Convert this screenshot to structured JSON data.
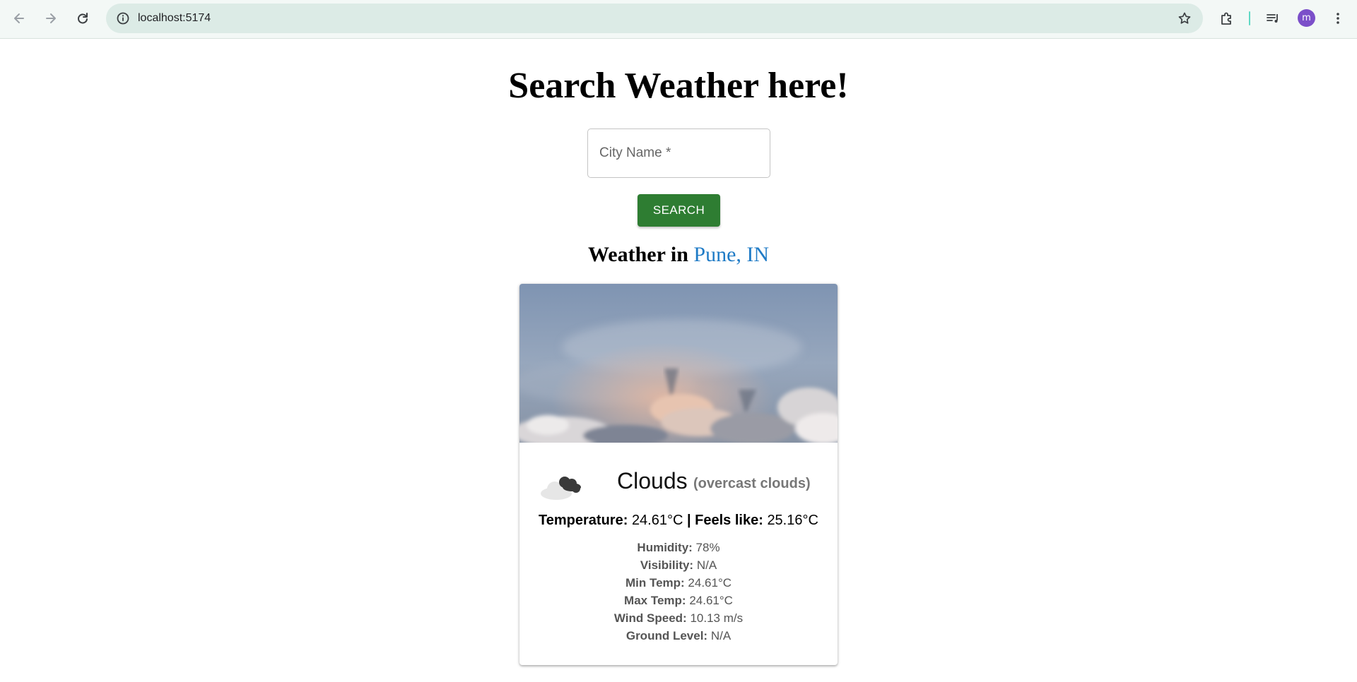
{
  "browser": {
    "url": "localhost:5174",
    "profile_initial": "m",
    "icons": [
      "back-arrow-icon",
      "forward-arrow-icon",
      "reload-icon",
      "info-icon",
      "star-icon",
      "extensions-icon",
      "media-icon",
      "kebab-menu-icon"
    ]
  },
  "page": {
    "title": "Search Weather here!",
    "city_input": {
      "placeholder": "City Name *",
      "value": ""
    },
    "search_button": "SEARCH",
    "weather_heading_prefix": "Weather in",
    "location": "Pune, IN"
  },
  "card": {
    "condition": "Clouds",
    "description": "(overcast clouds)",
    "temperature_label": "Temperature:",
    "temperature_value": "24.61°C",
    "feels_like_label": "| Feels like:",
    "feels_like_value": "25.16°C",
    "details": [
      {
        "label": "Humidity:",
        "value": "78%"
      },
      {
        "label": "Visibility:",
        "value": "N/A"
      },
      {
        "label": "Min Temp:",
        "value": "24.61°C"
      },
      {
        "label": "Max Temp:",
        "value": "24.61°C"
      },
      {
        "label": "Wind Speed:",
        "value": "10.13 m/s"
      },
      {
        "label": "Ground Level:",
        "value": "N/A"
      }
    ]
  },
  "colors": {
    "accent_button": "#2e7d32",
    "location_text": "#1f7bc6",
    "avatar": "#7b4fc9"
  }
}
